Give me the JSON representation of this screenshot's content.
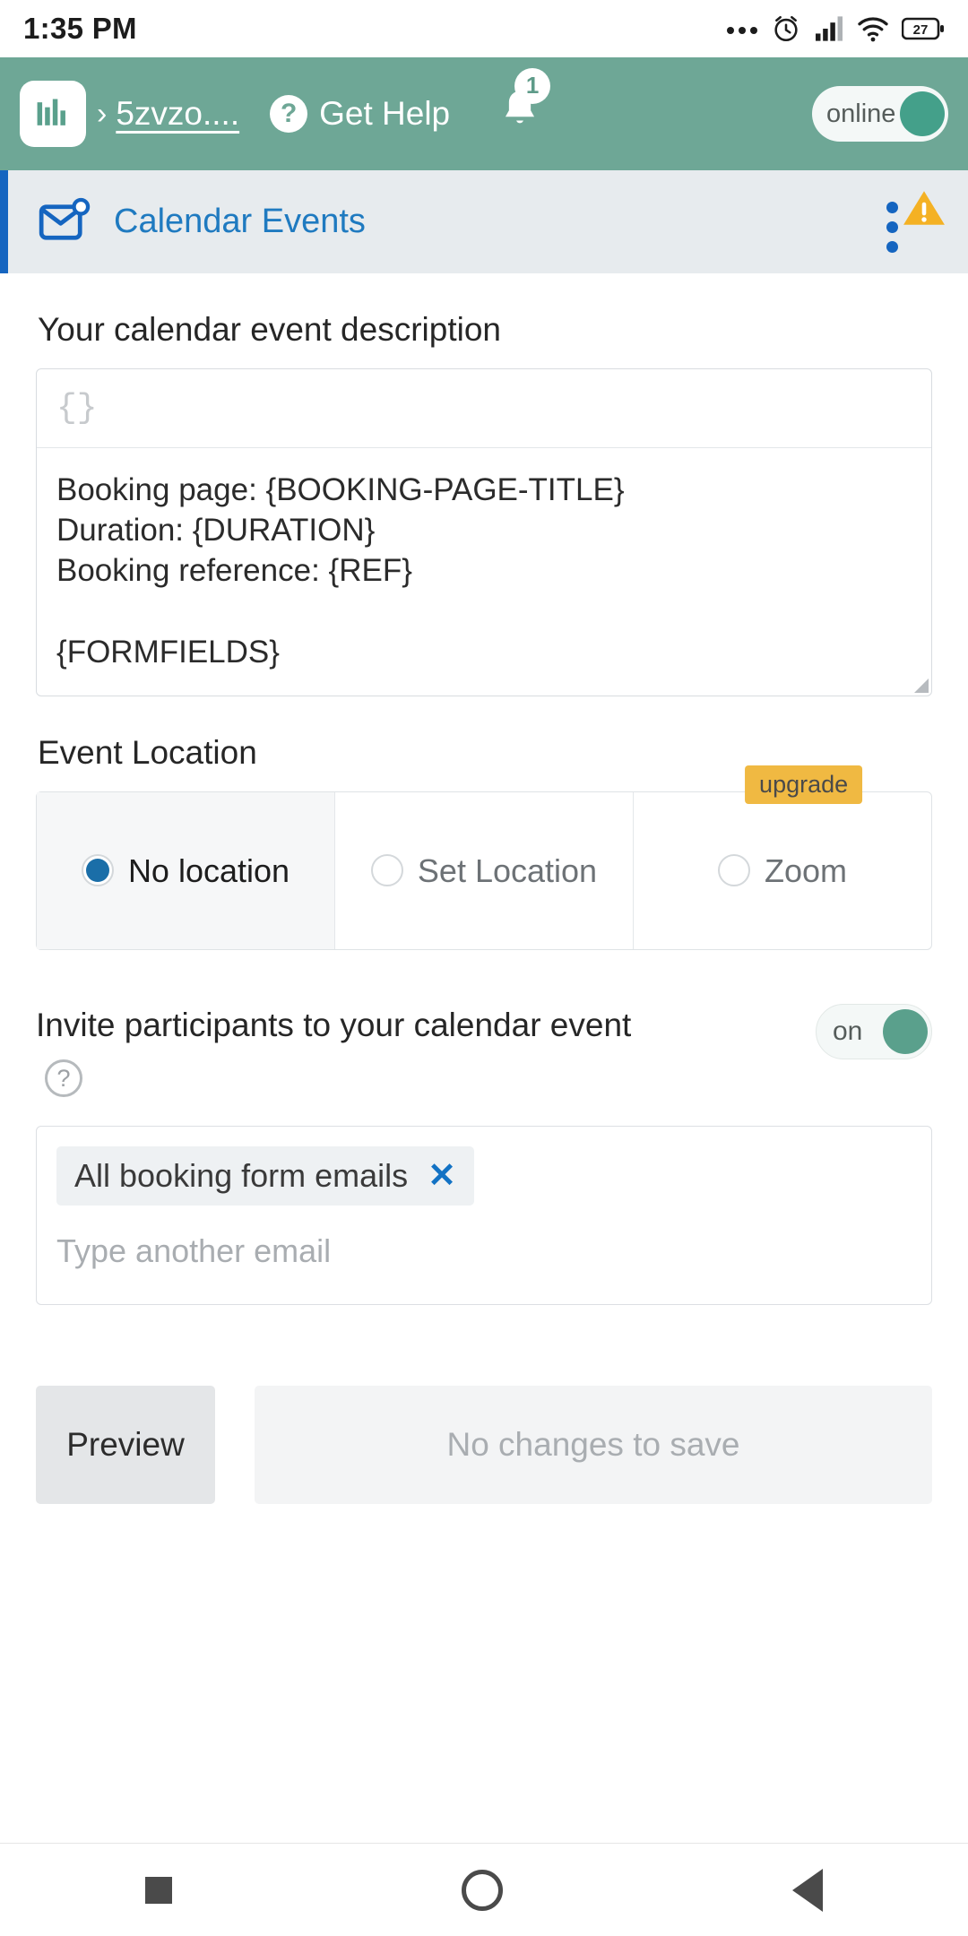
{
  "status_bar": {
    "time": "1:35 PM",
    "icons": [
      "more-dots-icon",
      "alarm-icon",
      "signal-icon",
      "wifi-icon",
      "battery-icon"
    ],
    "battery_level": "27"
  },
  "app_bar": {
    "logo": "bar-chart-logo",
    "separator": "›",
    "site_name": "5zvzo....",
    "help_label": "Get Help",
    "help_icon": "question-mark-icon",
    "notification_icon": "bell-icon",
    "notification_count": "1",
    "online_toggle": {
      "label": "online",
      "state": "on"
    },
    "background_color": "#6ea796"
  },
  "section_header": {
    "icon": "mail-event-icon",
    "title": "Calendar Events",
    "title_color": "#1f7ac0",
    "menu_icon": "kebab-menu-icon",
    "warning_icon": "warning-triangle-icon",
    "warning_color": "#f4b124",
    "accent_bar_color": "#1565c0",
    "background_color": "#e7ebee"
  },
  "description": {
    "label": "Your calendar event description",
    "toolbar_icon": "{}",
    "value": "Booking page: {BOOKING-PAGE-TITLE}\nDuration: {DURATION}\nBooking reference: {REF}\n\n{FORMFIELDS}"
  },
  "event_location": {
    "label": "Event Location",
    "options": [
      {
        "label": "No location",
        "selected": true,
        "badge": ""
      },
      {
        "label": "Set Location",
        "selected": false,
        "badge": ""
      },
      {
        "label": "Zoom",
        "selected": false,
        "badge": "upgrade"
      }
    ]
  },
  "invite": {
    "label": "Invite participants to your calendar event",
    "help_icon": "question-circle-icon",
    "toggle": {
      "label": "on",
      "state": "on"
    },
    "chips": [
      {
        "text": "All booking form emails",
        "remove_icon": "close-x-icon"
      }
    ],
    "input_placeholder": "Type another email"
  },
  "actions": {
    "preview_label": "Preview",
    "save_label": "No changes to save",
    "save_disabled": true
  },
  "nav_bar": {
    "recents_icon": "square-icon",
    "home_icon": "circle-icon",
    "back_icon": "triangle-back-icon"
  }
}
